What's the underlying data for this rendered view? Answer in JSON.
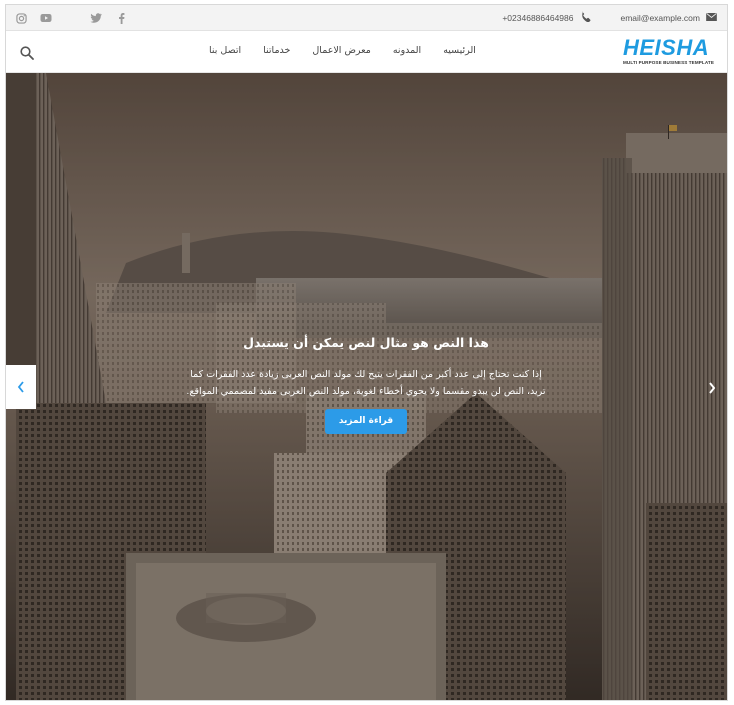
{
  "topbar": {
    "social": [
      "instagram-icon",
      "youtube-icon",
      "twitter-icon",
      "facebook-icon"
    ],
    "phone": "+02346886464986",
    "email": "email@example.com"
  },
  "nav": {
    "items": [
      "الرئيسيه",
      "المدونه",
      "معرض الاعمال",
      "خدماتنا",
      "اتصل بنا"
    ]
  },
  "logo": {
    "word": "HEISHA",
    "tagline": "MULTI PURPOSE BUSINESS TEMPLATE"
  },
  "hero": {
    "title": "هذا النص هو مثال لنص يمكن أن يستبدل",
    "text": "إذا كنت تحتاج إلى عدد أكبر من الفقرات يتيح لك مولد النص العربى زيادة عدد الفقرات كما تريد، النص لن يبدو مقسما ولا يحوي أخطاء لغوية، مولد النص العربى مفيد لمصممي المواقع.",
    "button": "قراءة المزيد"
  },
  "colors": {
    "accent": "#2c9be8",
    "logo": "#1e9be0",
    "topbar": "#f3f3f3"
  }
}
